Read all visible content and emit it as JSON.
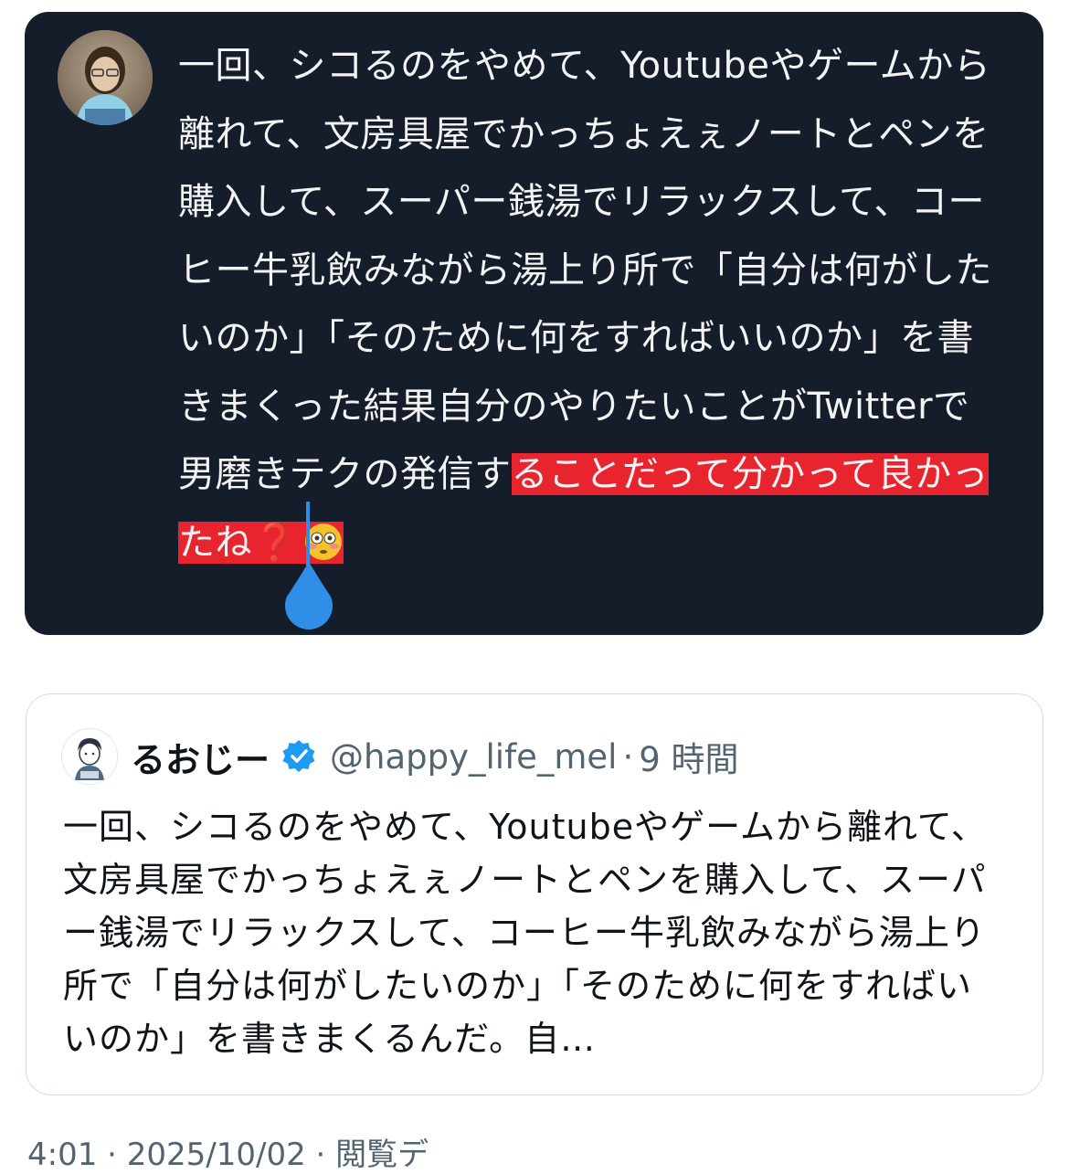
{
  "screenshot": {
    "text_before_highlight": "一回、シコるのをやめて、Youtubeやゲームから離れて、文房具屋でかっちょえぇノートとペンを購入して、スーパー銭湯でリラックスして、コーヒー牛乳飲みながら湯上り所で「自分は何がしたいのか」「そのために何をすればいいのか」を書きまくった結果自分のやりたいことがTwitterで男磨きテクの発信す",
    "highlighted_text": "ることだって分かって良かったね",
    "highlighted_mark": "❓",
    "emoji": "flushed-face-emoji",
    "colors": {
      "background": "#151d2a",
      "highlight": "#e8242f",
      "caret": "#2f8fe6"
    }
  },
  "quote": {
    "name": "るおじー",
    "verified": true,
    "handle": "@happy_life_mel",
    "separator": "·",
    "time": "9 時間",
    "body": "一回、シコるのをやめて、Youtubeやゲームから離れて、文房具屋でかっちょえぇノートとペンを購入して、スーパー銭湯でリラックスして、コーヒー牛乳飲みながら湯上り所で「自分は何がしたいのか」「そのために何をすればいいのか」を書きまくるんだ。自…",
    "colors": {
      "verified_badge": "#1d9bf0",
      "secondary_text": "#536471"
    }
  },
  "footer": {
    "meta": "4:01 · 2025/10/02 · 閲覧デ"
  }
}
